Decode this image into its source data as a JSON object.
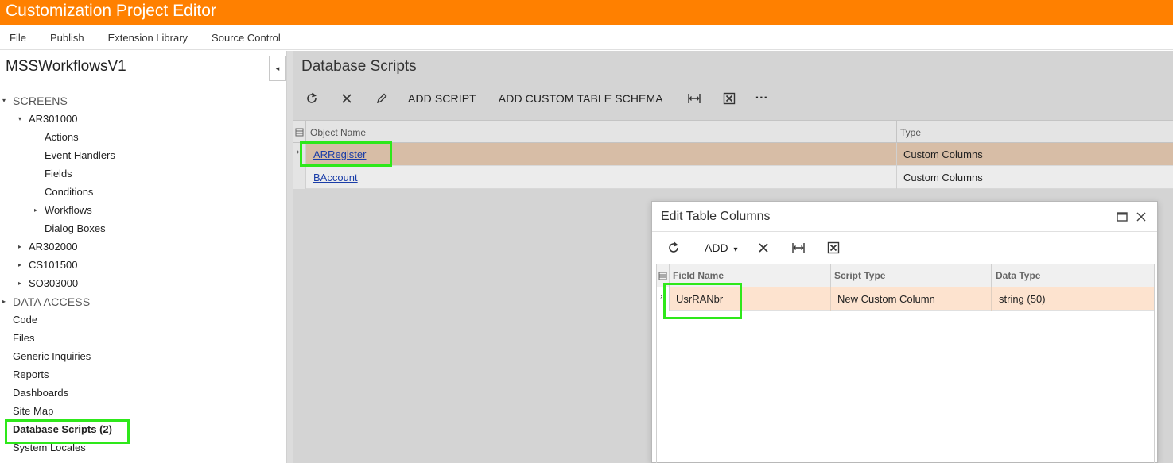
{
  "app": {
    "title": "Customization Project Editor"
  },
  "menu": {
    "items": [
      "File",
      "Publish",
      "Extension Library",
      "Source Control"
    ]
  },
  "sidebar": {
    "project_name": "MSSWorkflowsV1",
    "collapse_glyph": "◂",
    "tree": [
      {
        "label": "SCREENS",
        "level": 0,
        "kind": "section",
        "arrow": "▾"
      },
      {
        "label": "AR301000",
        "level": 1,
        "arrow": "▾"
      },
      {
        "label": "Actions",
        "level": 2
      },
      {
        "label": "Event Handlers",
        "level": 2
      },
      {
        "label": "Fields",
        "level": 2
      },
      {
        "label": "Conditions",
        "level": 2
      },
      {
        "label": "Workflows",
        "level": 2,
        "arrow": "▸"
      },
      {
        "label": "Dialog Boxes",
        "level": 2
      },
      {
        "label": "AR302000",
        "level": 1,
        "arrow": "▸"
      },
      {
        "label": "CS101500",
        "level": 1,
        "arrow": "▸"
      },
      {
        "label": "SO303000",
        "level": 1,
        "arrow": "▸"
      },
      {
        "label": "DATA ACCESS",
        "level": 0,
        "kind": "section",
        "arrow": "▸"
      },
      {
        "label": "Code",
        "level": 0
      },
      {
        "label": "Files",
        "level": 0
      },
      {
        "label": "Generic Inquiries",
        "level": 0
      },
      {
        "label": "Reports",
        "level": 0
      },
      {
        "label": "Dashboards",
        "level": 0
      },
      {
        "label": "Site Map",
        "level": 0
      },
      {
        "label": "Database Scripts (2)",
        "level": 0,
        "bold": true,
        "selected": true
      },
      {
        "label": "System Locales",
        "level": 0
      }
    ]
  },
  "main": {
    "title": "Database Scripts",
    "toolbar": {
      "refresh_icon": "refresh-icon",
      "delete_icon": "close-icon",
      "edit_icon": "pencil-icon",
      "add_script": "ADD SCRIPT",
      "add_custom_table_schema": "ADD CUSTOM TABLE SCHEMA",
      "fit_columns_icon": "fit-columns-icon",
      "excel_icon": "excel-export-icon",
      "more": "···"
    },
    "grid": {
      "columns": [
        "Object Name",
        "Type"
      ],
      "rows": [
        {
          "name": "ARRegister",
          "type": "Custom Columns",
          "active": true
        },
        {
          "name": "BAccount",
          "type": "Custom Columns",
          "active": false
        }
      ]
    }
  },
  "dialog": {
    "title": "Edit Table Columns",
    "toolbar": {
      "refresh_icon": "refresh-icon",
      "add_label": "ADD",
      "add_caret": "▾",
      "delete_icon": "close-icon",
      "fit_columns_icon": "fit-columns-icon",
      "excel_icon": "excel-export-icon"
    },
    "grid": {
      "columns": [
        "Field Name",
        "Script Type",
        "Data Type"
      ],
      "rows": [
        {
          "field_name": "UsrRANbr",
          "script_type": "New Custom Column",
          "data_type": "string (50)"
        }
      ]
    }
  },
  "colors": {
    "title_bar": "#ff8000",
    "highlight": "#2ee81a",
    "active_row": "#d7bda6",
    "dialog_row": "#fde3cf",
    "link": "#1a3da8"
  }
}
